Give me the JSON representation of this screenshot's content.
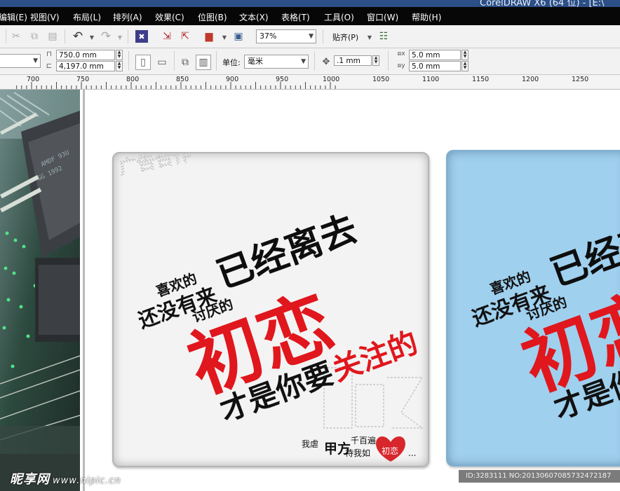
{
  "title": {
    "text": "CorelDRAW X6 (64 位) - [E:\\"
  },
  "menu": [
    "编辑(E)",
    "视图(V)",
    "布局(L)",
    "排列(A)",
    "效果(C)",
    "位图(B)",
    "文本(X)",
    "表格(T)",
    "工具(O)",
    "窗口(W)",
    "帮助(H)"
  ],
  "toolbar1": {
    "zoom": "37%",
    "snap": "贴齐(P)"
  },
  "toolbar2": {
    "width": "750.0 mm",
    "height": "4,197.0 mm",
    "unit_label": "单位:",
    "unit_value": "毫米",
    "nudge": ".1 mm",
    "dup_x": "5.0 mm",
    "dup_y": "5.0 mm"
  },
  "ruler": [
    "700",
    "750",
    "800",
    "850",
    "900",
    "950",
    "1000",
    "1050",
    "1100",
    "1150",
    "1200",
    "1250"
  ],
  "poster": {
    "line1": "已经离去",
    "small_top": "喜欢的",
    "small_mid": "还没有来",
    "small_low": "讨厌的",
    "big": "初恋",
    "line3a": "才是你要",
    "line3b": "关注的",
    "vertical_ghost": "广告合作",
    "footer_a": "我虐",
    "footer_b": "甲方",
    "footer_c": "千百遍",
    "footer_d": "待我如",
    "heart_text": "初恋",
    "ellipsis": "..."
  },
  "watermark": {
    "brand": "昵享网",
    "url": "www.nipic.cn",
    "id": "ID:3283111 NO:20130607085732472187"
  },
  "colors": {
    "accent_red": "#e0171d",
    "card_blue": "#9fd0ee",
    "menu_bg": "#070707"
  }
}
